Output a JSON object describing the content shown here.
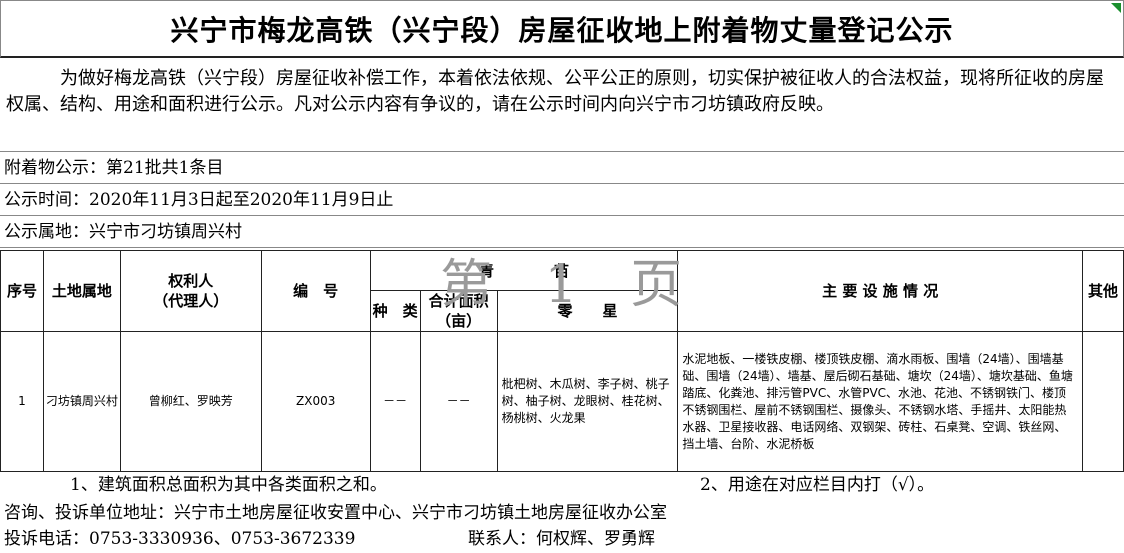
{
  "title": "兴宁市梅龙高铁（兴宁段）房屋征收地上附着物丈量登记公示",
  "intro": "为做好梅龙高铁（兴宁段）房屋征收补偿工作，本着依法依规、公平公正的原则，切实保护被征收人的合法权益，现将所征收的房屋权属、结构、用途和面积进行公示。凡对公示内容有争议的，请在公示时间内向兴宁市刁坊镇政府反映。",
  "info": {
    "batch": "附着物公示：第21批共1条目",
    "period": "公示时间：2020年11月3日起至2020年11月9日止",
    "location": "公示属地：兴宁市刁坊镇周兴村"
  },
  "watermark": "第 1 页",
  "headers": {
    "index": "序号",
    "land": "土地属地",
    "owner_line1": "权利人",
    "owner_line2": "（代理人）",
    "code": "编　号",
    "seedling": "青　　　　苗",
    "kind": "种　类",
    "area_line1": "合计面积",
    "area_line2": "（亩）",
    "scattered": "零　　星",
    "facilities": "主 要 设 施 情 况",
    "other": "其他"
  },
  "rows": [
    {
      "index": "1",
      "land": "刁坊镇周兴村",
      "owner": "曾柳红、罗映芳",
      "code": "ZX003",
      "kind": "－－",
      "area": "－－",
      "scattered": "枇杷树、木瓜树、李子树、桃子树、柚子树、龙眼树、桂花树、杨桃树、火龙果",
      "facilities": "水泥地板、一楼铁皮棚、楼顶铁皮棚、滴水雨板、围墙（24墙）、围墙基础、围墙（24墙）、墙基、屋后砌石基础、塘坎（24墙）、塘坎基础、鱼塘踏底、化粪池、排污管PVC、水管PVC、水池、花池、不锈钢铁门、楼顶不锈钢围栏、屋前不锈钢围栏、摄像头、不锈钢水塔、手摇井、太阳能热水器、卫星接收器、电话网络、双钢架、砖柱、石桌凳、空调、铁丝网、挡土墙、台阶、水泥桥板",
      "other": ""
    }
  ],
  "notes": {
    "note1": "1、建筑面积总面积为其中各类面积之和。",
    "note2": "2、用途在对应栏目内打（√）。"
  },
  "footer": {
    "address": "咨询、投诉单位地址：兴宁市土地房屋征收安置中心、兴宁市刁坊镇土地房屋征收办公室",
    "phone": "投诉电话：0753-3330936、0753-3672339",
    "contact": "联系人：何权辉、罗勇辉"
  },
  "colors": {
    "corner_marker": "#1a8f2e",
    "watermark": "#9a9a9a"
  }
}
